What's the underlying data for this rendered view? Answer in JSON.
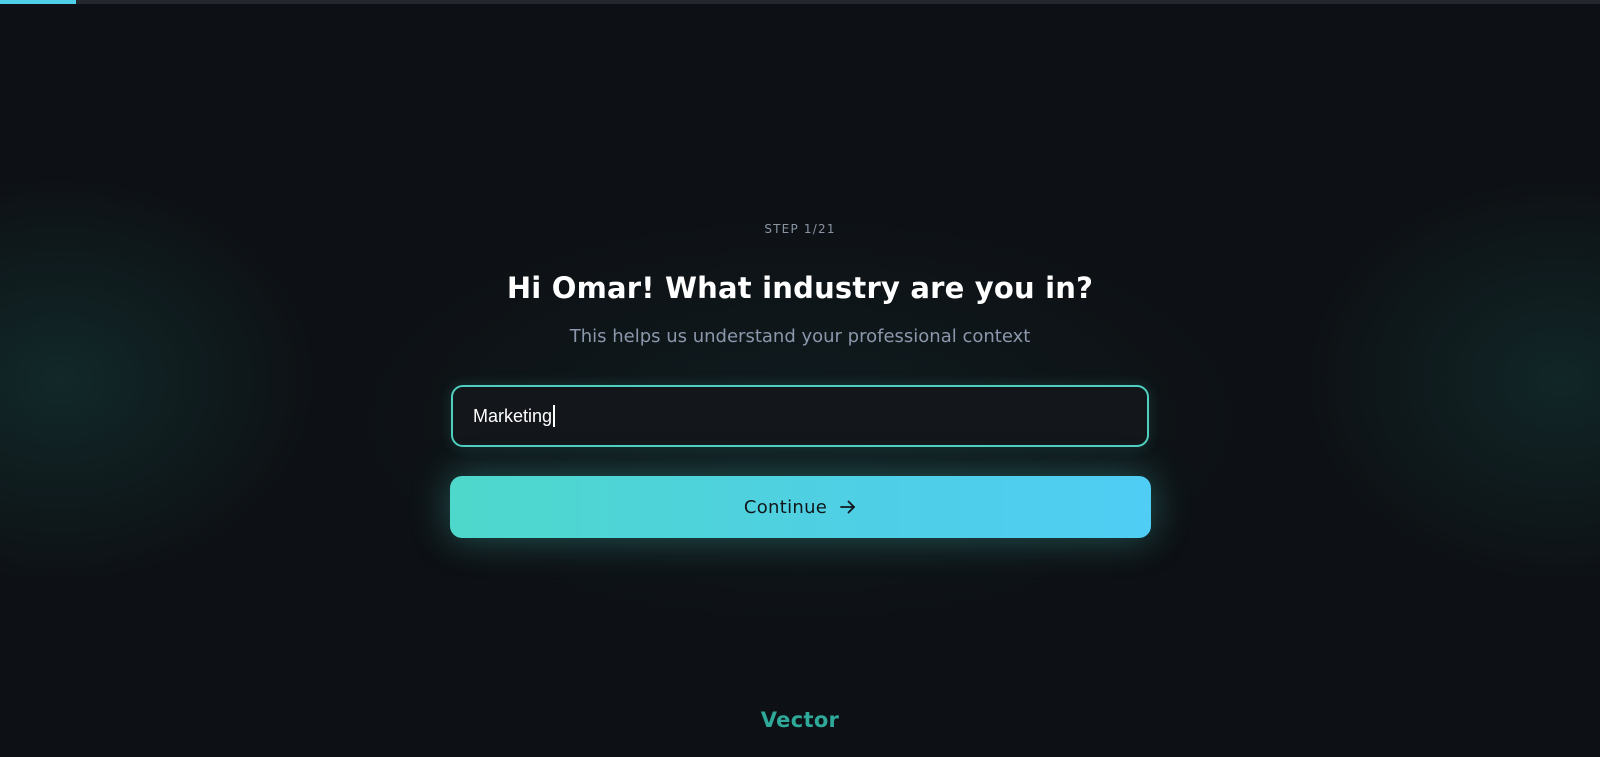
{
  "progress": {
    "current_step": 1,
    "total_steps": 21,
    "fraction": 0.0476,
    "color": "#4fd0e8"
  },
  "step": {
    "label": "STEP 1/21"
  },
  "question": {
    "title": "Hi Omar! What industry are you in?",
    "subtitle": "This helps us understand your professional context"
  },
  "industry_input": {
    "value": "Marketing",
    "border_color": "#4ecfbf"
  },
  "continue_button": {
    "label": "Continue",
    "icon": "arrow-right-icon"
  },
  "footer": {
    "logo": "Vector",
    "logo_color": "#2ea99a"
  },
  "colors": {
    "background": "#0d1014",
    "accent_start": "#4ed8cb",
    "accent_end": "#4fcdf4"
  }
}
